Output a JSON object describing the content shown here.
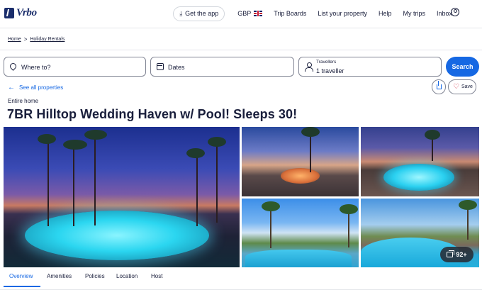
{
  "header": {
    "logo_text": "Vrbo",
    "get_app": "Get the app",
    "currency": "GBP",
    "trip_boards": "Trip Boards",
    "list_property": "List your property",
    "help": "Help",
    "my_trips": "My trips",
    "inbox": "Inbox"
  },
  "breadcrumb": {
    "home": "Home",
    "separator": ">",
    "holiday_rentals": "Holiday Rentals"
  },
  "search": {
    "where_placeholder": "Where to?",
    "dates_placeholder": "Dates",
    "travellers_label": "Travellers",
    "travellers_value": "1 traveller",
    "search_button": "Search"
  },
  "listing": {
    "back_link": "See all properties",
    "save_label": "Save",
    "property_type": "Entire home",
    "title": "7BR Hilltop Wedding Haven w/ Pool! Sleeps 30!",
    "photo_count": "92+"
  },
  "tabs": [
    "Overview",
    "Amenities",
    "Policies",
    "Location",
    "Host"
  ],
  "colors": {
    "brand": "#1a2d6b",
    "accent": "#1668e3",
    "text": "#191e3b",
    "heart": "#d1293d"
  }
}
